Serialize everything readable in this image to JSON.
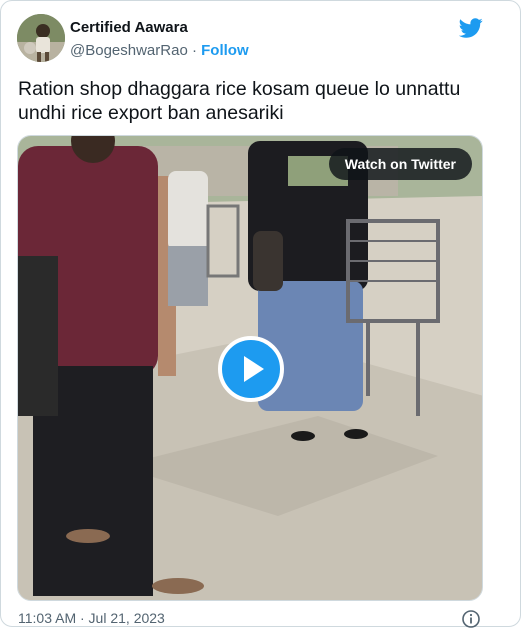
{
  "user": {
    "display_name": "Certified Aawara",
    "handle": "@BogeshwarRao",
    "separator": " · ",
    "follow_label": "Follow"
  },
  "tweet": {
    "text": "Ration shop dhaggara rice kosam queue lo unnattu undhi rice export ban anesariki"
  },
  "media": {
    "watch_label": "Watch on Twitter",
    "play_icon": "play-icon"
  },
  "footer": {
    "timestamp": "11:03 AM · Jul 21, 2023",
    "info_icon": "info-icon"
  },
  "colors": {
    "twitter_blue": "#1d9bf0",
    "secondary_text": "#536471"
  }
}
